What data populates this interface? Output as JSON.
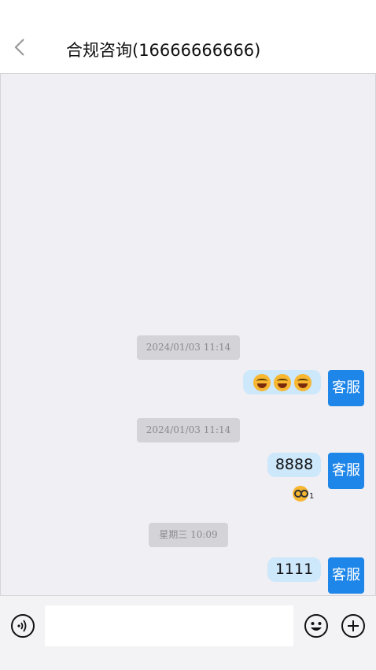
{
  "header": {
    "title": "合规咨询(16666666666)"
  },
  "messages": [
    {
      "timestamp": "2024/01/03 11:14",
      "content_emojis": [
        "joy-icon",
        "joy-icon",
        "joy-icon"
      ],
      "avatar": "客服"
    },
    {
      "timestamp": "2024/01/03 11:14",
      "text": "8888",
      "avatar": "客服",
      "reaction": {
        "emoji": "nerd-face-icon",
        "count": "1"
      }
    },
    {
      "timestamp": "星期三 10:09",
      "text": "1111",
      "avatar": "客服"
    }
  ],
  "footer": {
    "input_placeholder": "",
    "icons": [
      "voice-icon",
      "smiley-icon",
      "plus-icon"
    ]
  },
  "colors": {
    "accent": "#1e86e8",
    "bubble": "#cde7fb",
    "chat_bg": "#efeff4",
    "timestamp_bg": "#d4d4d8"
  }
}
